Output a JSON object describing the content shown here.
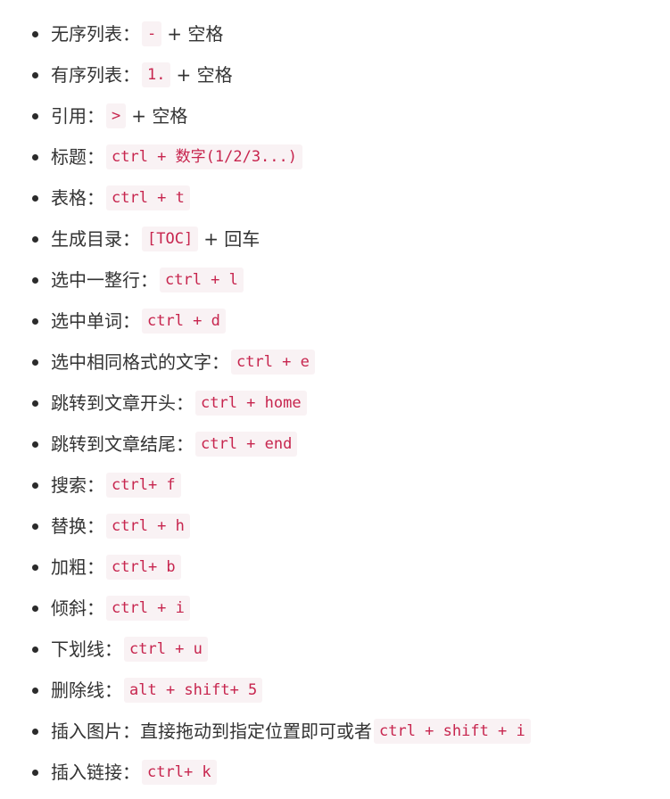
{
  "items": [
    {
      "label": "无序列表：",
      "code": "-",
      "suffix": "+ 空格"
    },
    {
      "label": "有序列表：",
      "code": "1.",
      "suffix": "+ 空格"
    },
    {
      "label": "引用：",
      "code": ">",
      "suffix": "+ 空格"
    },
    {
      "label": "标题：",
      "code": "ctrl + 数字(1/2/3...)",
      "suffix": ""
    },
    {
      "label": "表格：",
      "code": "ctrl + t",
      "suffix": ""
    },
    {
      "label": "生成目录：",
      "code": "[TOC]",
      "suffix": "+ 回车"
    },
    {
      "label": "选中一整行：",
      "code": "ctrl + l",
      "suffix": ""
    },
    {
      "label": "选中单词：",
      "code": "ctrl + d",
      "suffix": ""
    },
    {
      "label": "选中相同格式的文字：",
      "code": "ctrl + e",
      "suffix": ""
    },
    {
      "label": "跳转到文章开头：",
      "code": "ctrl + home",
      "suffix": ""
    },
    {
      "label": "跳转到文章结尾：",
      "code": "ctrl + end",
      "suffix": ""
    },
    {
      "label": "搜索：",
      "code": "ctrl+ f",
      "suffix": ""
    },
    {
      "label": "替换：",
      "code": "ctrl + h",
      "suffix": ""
    },
    {
      "label": "加粗：",
      "code": "ctrl+ b",
      "suffix": ""
    },
    {
      "label": "倾斜：",
      "code": "ctrl + i",
      "suffix": ""
    },
    {
      "label": "下划线：",
      "code": "ctrl + u",
      "suffix": ""
    },
    {
      "label": "删除线：",
      "code": "alt + shift+ 5",
      "suffix": ""
    },
    {
      "label": "插入图片：直接拖动到指定位置即可或者",
      "code": "ctrl + shift + i",
      "suffix": ""
    },
    {
      "label": "插入链接：",
      "code": "ctrl+ k",
      "suffix": ""
    }
  ]
}
